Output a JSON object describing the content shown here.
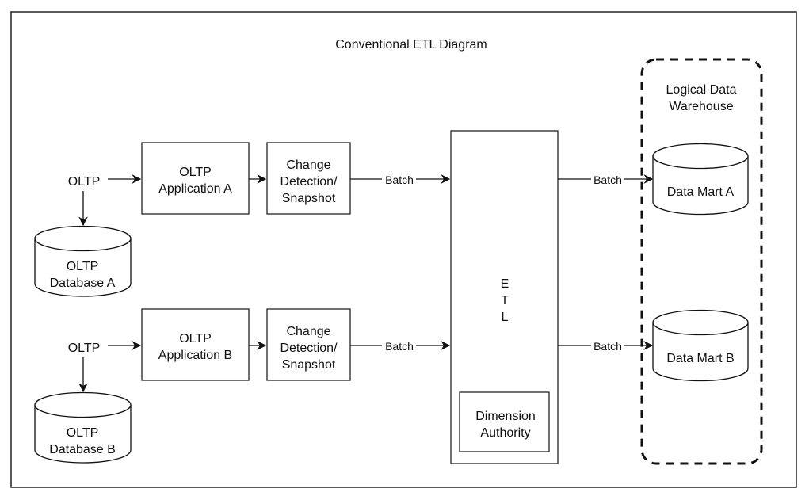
{
  "title": "Conventional ETL Diagram",
  "sources": [
    {
      "oltp_label": "OLTP",
      "application": [
        "OLTP",
        "Application A"
      ],
      "database": [
        "OLTP",
        "Database A"
      ],
      "change_detection": [
        "Change",
        "Detection/",
        "Snapshot"
      ],
      "batch_label": "Batch"
    },
    {
      "oltp_label": "OLTP",
      "application": [
        "OLTP",
        "Application B"
      ],
      "database": [
        "OLTP",
        "Database B"
      ],
      "change_detection": [
        "Change",
        "Detection/",
        "Snapshot"
      ],
      "batch_label": "Batch"
    }
  ],
  "etl": {
    "letters": [
      "E",
      "T",
      "L"
    ],
    "dimension_authority": [
      "Dimension",
      "Authority"
    ]
  },
  "warehouse": {
    "label": [
      "Logical Data",
      "Warehouse"
    ],
    "marts": [
      {
        "name": "Data Mart A",
        "batch_label": "Batch"
      },
      {
        "name": "Data Mart B",
        "batch_label": "Batch"
      }
    ]
  },
  "colors": {
    "stroke": "#111111",
    "background": "#ffffff"
  }
}
